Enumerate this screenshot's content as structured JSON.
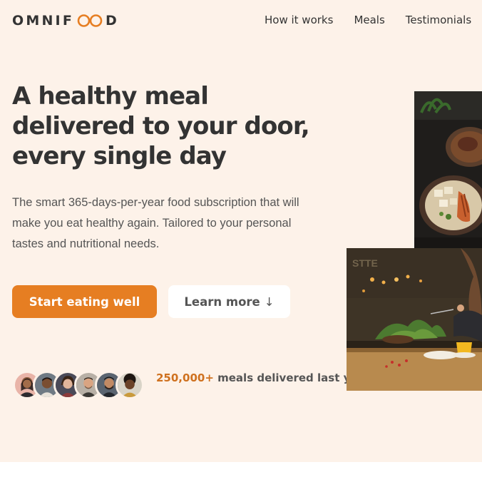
{
  "logo": {
    "text_before": "OMNIF",
    "text_after": "D"
  },
  "nav": {
    "items": [
      {
        "label": "How it works"
      },
      {
        "label": "Meals"
      },
      {
        "label": "Testimonials"
      }
    ]
  },
  "hero": {
    "title": "A healthy meal delivered to your door, every single day",
    "description": "The smart 365-days-per-year food subscription that will make you eat healthy again. Tailored to your personal tastes and nutritional needs.",
    "primary_button": "Start eating well",
    "secondary_button": "Learn more",
    "secondary_arrow": "↓",
    "delivered_count": "250,000+",
    "delivered_text": "meals delivered last year!"
  },
  "colors": {
    "accent": "#e67e22",
    "background": "#fdf2e9",
    "text": "#333333"
  }
}
